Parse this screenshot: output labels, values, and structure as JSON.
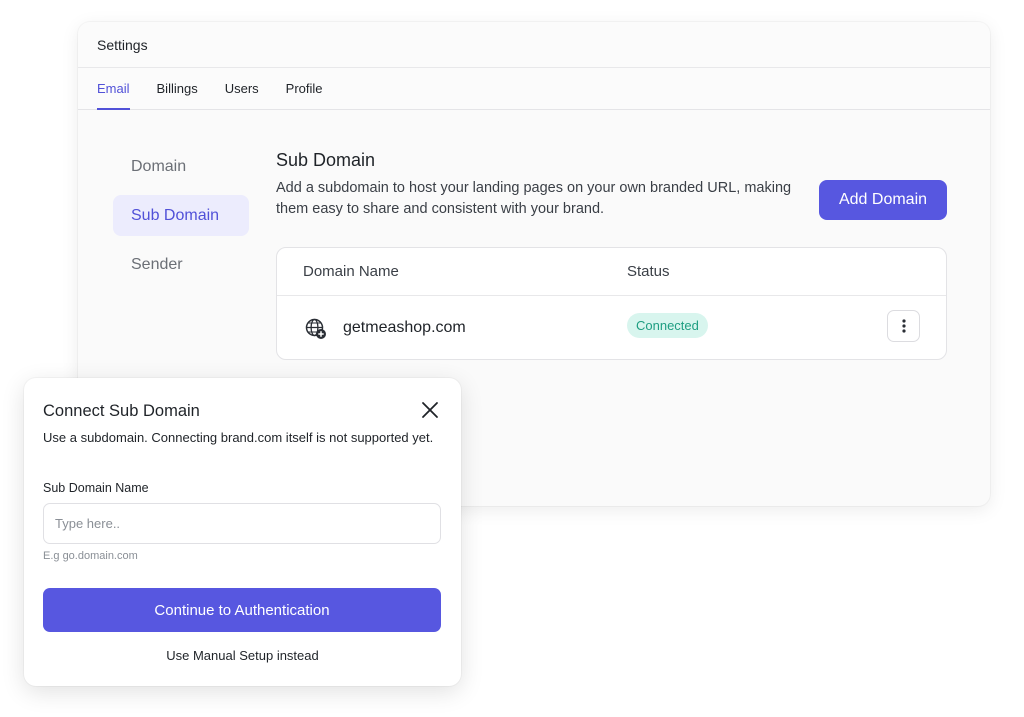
{
  "window": {
    "title": "Settings"
  },
  "tabs": [
    {
      "label": "Email",
      "active": true
    },
    {
      "label": "Billings",
      "active": false
    },
    {
      "label": "Users",
      "active": false
    },
    {
      "label": "Profile",
      "active": false
    }
  ],
  "side_nav": [
    {
      "label": "Domain",
      "active": false
    },
    {
      "label": "Sub Domain",
      "active": true
    },
    {
      "label": "Sender",
      "active": false
    }
  ],
  "section": {
    "title": "Sub Domain",
    "description": "Add a subdomain to host your landing pages on your own branded URL, making them easy to share and consistent with your brand.",
    "add_button": "Add Domain"
  },
  "table": {
    "headers": [
      "Domain Name",
      "Status"
    ],
    "rows": [
      {
        "domain": "getmeashop.com",
        "status": "Connected",
        "icon": "globe-icon",
        "menu_icon": "kebab-icon"
      }
    ]
  },
  "modal": {
    "title": "Connect Sub Domain",
    "description": "Use a subdomain. Connecting brand.com itself is not supported yet.",
    "field_label": "Sub Domain Name",
    "input_value": "",
    "input_placeholder": "Type here..",
    "hint": "E.g go.domain.com",
    "continue_button": "Continue to Authentication",
    "manual_link": "Use Manual Setup instead",
    "close_icon": "close-icon"
  },
  "colors": {
    "accent": "#5757e0",
    "accent_text": "#5151d8",
    "active_bg": "#ececfd",
    "status_bg": "#d8f5ee",
    "status_text": "#1f9e82"
  }
}
